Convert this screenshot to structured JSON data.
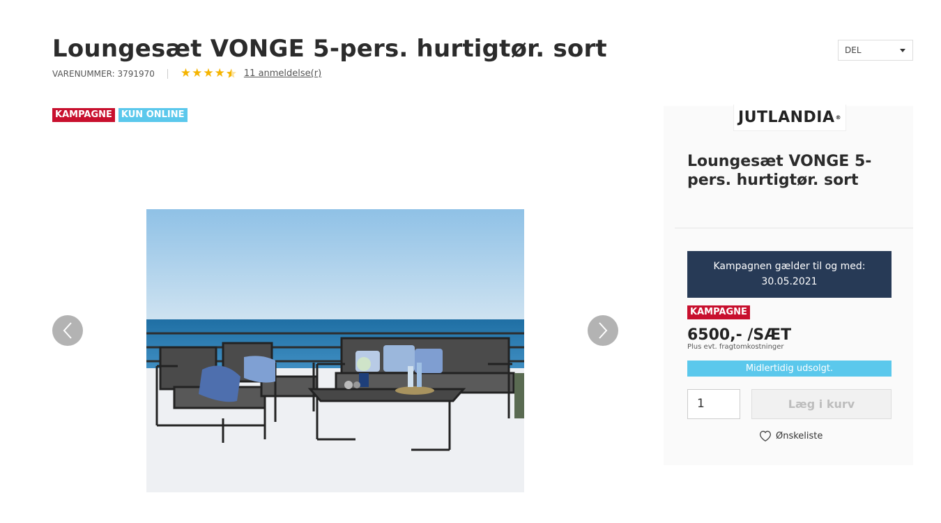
{
  "product": {
    "title": "Loungesæt VONGE 5-pers. hurtigtør. sort",
    "item_number_label": "VARENUMMER: 3791970",
    "rating": 4.5,
    "reviews_link": "11 anmeldelse(r)"
  },
  "share": {
    "label": "DEL"
  },
  "badges": {
    "campaign": "KAMPAGNE",
    "online_only": "KUN ONLINE"
  },
  "panel": {
    "brand": "JUTLANDIA",
    "brand_mark": "®",
    "title": "Loungesæt VONGE 5-pers. hurtigtør. sort",
    "campaign_line1": "Kampagnen gælder til og med:",
    "campaign_date": "30.05.2021",
    "badge": "KAMPAGNE",
    "price": "6500,- /SÆT",
    "price_note": "Plus evt. fragtomkostninger",
    "stock_status": "Midlertidig udsolgt.",
    "quantity": "1",
    "add_to_cart": "Læg i kurv",
    "wishlist": "Ønskeliste"
  },
  "colors": {
    "campaign_red": "#c8102e",
    "online_blue": "#5bc8ec",
    "campaign_box_navy": "#273a56",
    "star_yellow": "#f5b400"
  }
}
